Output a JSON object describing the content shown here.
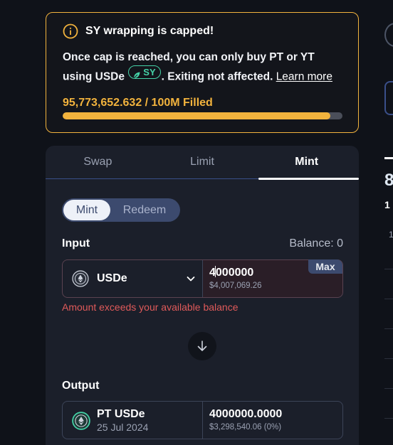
{
  "notice": {
    "title": "SY wrapping is capped!",
    "body_part1": "Once cap is reached, you can only buy PT or YT using USDe",
    "sy_label": "SY",
    "body_part2": ". Exiting not affected.",
    "learn_more": "Learn more",
    "cap_text": "95,773,652.632 / 100M Filled",
    "cap_fraction": 0.9577,
    "accent_color": "#f2b33d"
  },
  "tabs": [
    {
      "label": "Swap",
      "active": false
    },
    {
      "label": "Limit",
      "active": false
    },
    {
      "label": "Mint",
      "active": true
    }
  ],
  "mode": {
    "mint": "Mint",
    "redeem": "Redeem"
  },
  "input": {
    "label": "Input",
    "balance": "Balance: 0",
    "token": "USDe",
    "amount_before_caret": "4",
    "amount_after_caret": "000000",
    "usd": "$4,007,069.26",
    "max": "Max",
    "error": "Amount exceeds your available balance"
  },
  "output": {
    "label": "Output",
    "token": "PT USDe",
    "maturity": "25 Jul 2024",
    "amount": "4000000.0000",
    "usd": "$3,298,540.06 (0%)"
  },
  "right_peek": {
    "big": "8",
    "small": "1",
    "tiny": "1"
  }
}
